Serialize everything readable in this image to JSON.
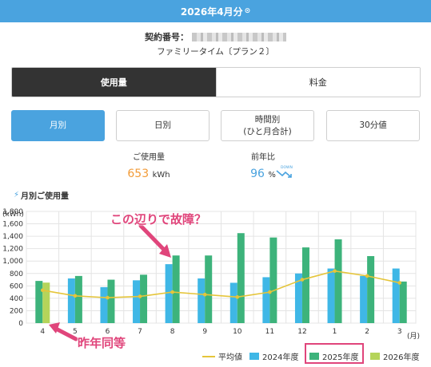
{
  "header": {
    "title": "2026年4月分"
  },
  "contract": {
    "label": "契約番号：",
    "plan": "ファミリータイム〔プラン２〕"
  },
  "segment": {
    "usage": "使用量",
    "fee": "料金"
  },
  "tabs": [
    {
      "label": "月別",
      "active": true
    },
    {
      "label": "日別",
      "active": false
    },
    {
      "label": "時間別\n(ひと月合計)",
      "active": false
    },
    {
      "label": "30分値",
      "active": false
    }
  ],
  "stats": {
    "usage_label": "ご使用量",
    "usage_value": "653",
    "usage_unit": "kWh",
    "yoy_label": "前年比",
    "yoy_value": "96",
    "yoy_unit": "%",
    "yoy_badge": "DOWN"
  },
  "section": {
    "title": "月別ご使用量"
  },
  "annotations": {
    "failure": "この辺りで故障？",
    "same_period": "昨年同等"
  },
  "colors": {
    "accent": "#4aa3df",
    "s2024": "#3fb7e6",
    "s2025": "#3db37b",
    "s2026": "#b5d45a",
    "avg": "#e5c53a",
    "annotation": "#e0457b"
  },
  "chart_data": {
    "type": "bar",
    "ylabel": "(kWh)",
    "xunit": "(月)",
    "ylim": [
      0,
      1800
    ],
    "yticks": [
      "0",
      "200",
      "400",
      "600",
      "800",
      "1,000",
      "1,200",
      "1,400",
      "1,600",
      "1,800"
    ],
    "categories": [
      "4",
      "5",
      "6",
      "7",
      "8",
      "9",
      "10",
      "11",
      "12",
      "1",
      "2",
      "3"
    ],
    "series": [
      {
        "name": "2024年度",
        "values": [
          null,
          720,
          580,
          690,
          950,
          720,
          650,
          740,
          800,
          880,
          760,
          880
        ]
      },
      {
        "name": "2025年度",
        "values": [
          680,
          760,
          700,
          780,
          1090,
          1090,
          1450,
          1380,
          1220,
          1350,
          1080,
          670
        ]
      },
      {
        "name": "2026年度",
        "values": [
          653,
          null,
          null,
          null,
          null,
          null,
          null,
          null,
          null,
          null,
          null,
          null
        ]
      }
    ],
    "average": {
      "name": "平均値",
      "values": [
        530,
        440,
        410,
        430,
        500,
        460,
        420,
        500,
        700,
        840,
        760,
        650
      ]
    },
    "grid": true
  }
}
